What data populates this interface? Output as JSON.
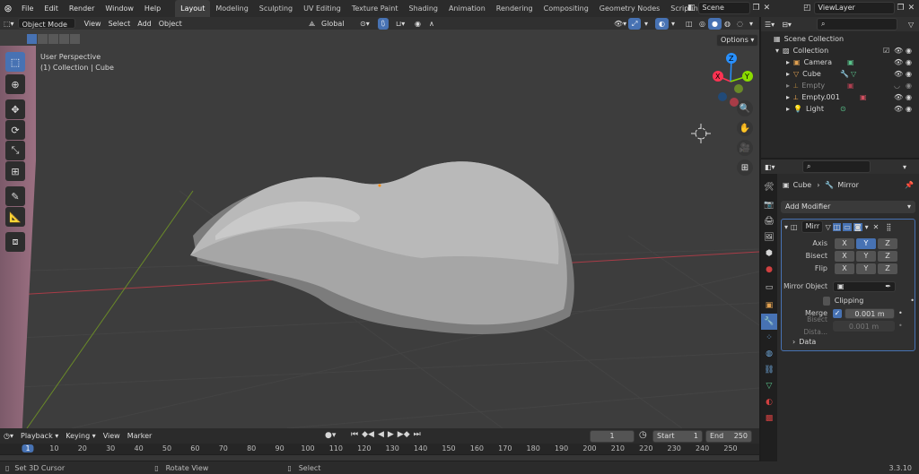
{
  "menus": [
    "File",
    "Edit",
    "Render",
    "Window",
    "Help"
  ],
  "workspaces": [
    "Layout",
    "Modeling",
    "Sculpting",
    "UV Editing",
    "Texture Paint",
    "Shading",
    "Animation",
    "Rendering",
    "Compositing",
    "Geometry Nodes",
    "Scripting"
  ],
  "scene": "Scene",
  "view_layer": "ViewLayer",
  "viewport_header": {
    "mode": "Object Mode",
    "menus": [
      "View",
      "Select",
      "Add",
      "Object"
    ],
    "transform": "Global",
    "options": "Options"
  },
  "viewport": {
    "perspective": "User Perspective",
    "collection_info": "(1) Collection | Cube",
    "gizmo": {
      "x": "X",
      "y": "Y",
      "z": "Z"
    }
  },
  "outliner": {
    "root": "Scene Collection",
    "collection": "Collection",
    "items": [
      {
        "label": "Camera",
        "dim": false
      },
      {
        "label": "Cube",
        "dim": false
      },
      {
        "label": "Empty",
        "dim": true
      },
      {
        "label": "Empty.001",
        "dim": false
      },
      {
        "label": "Light",
        "dim": false
      }
    ]
  },
  "properties": {
    "breadcrumb_object": "Cube",
    "breadcrumb_modifier": "Mirror",
    "add_modifier": "Add Modifier",
    "modifier_name": "Mirr",
    "labels": {
      "axis": "Axis",
      "bisect": "Bisect",
      "flip": "Flip",
      "mirror_object": "Mirror Object",
      "clipping": "Clipping",
      "merge": "Merge",
      "bisect_distance": "Bisect Dista...",
      "data": "Data"
    },
    "xyz": [
      "X",
      "Y",
      "Z"
    ],
    "merge_value": "0.001 m",
    "bisect_value": "0.001 m"
  },
  "timeline": {
    "menus": [
      "Playback",
      "Keying",
      "View",
      "Marker"
    ],
    "current_frame": "1",
    "start_label": "Start",
    "start": "1",
    "end_label": "End",
    "end": "250",
    "ticks": [
      "1",
      "10",
      "20",
      "30",
      "40",
      "50",
      "60",
      "70",
      "80",
      "90",
      "100",
      "110",
      "120",
      "130",
      "140",
      "150",
      "160",
      "170",
      "180",
      "190",
      "200",
      "210",
      "220",
      "230",
      "240",
      "250"
    ]
  },
  "status": {
    "left": "Set 3D Cursor",
    "middle": "Rotate View",
    "right": "Select",
    "version": "3.3.10"
  },
  "colors": {
    "accent": "#4772b3",
    "x_axis": "#ff3352",
    "y_axis": "#8bdc00",
    "z_axis": "#2890ff",
    "current_frame": "#4772b3"
  }
}
